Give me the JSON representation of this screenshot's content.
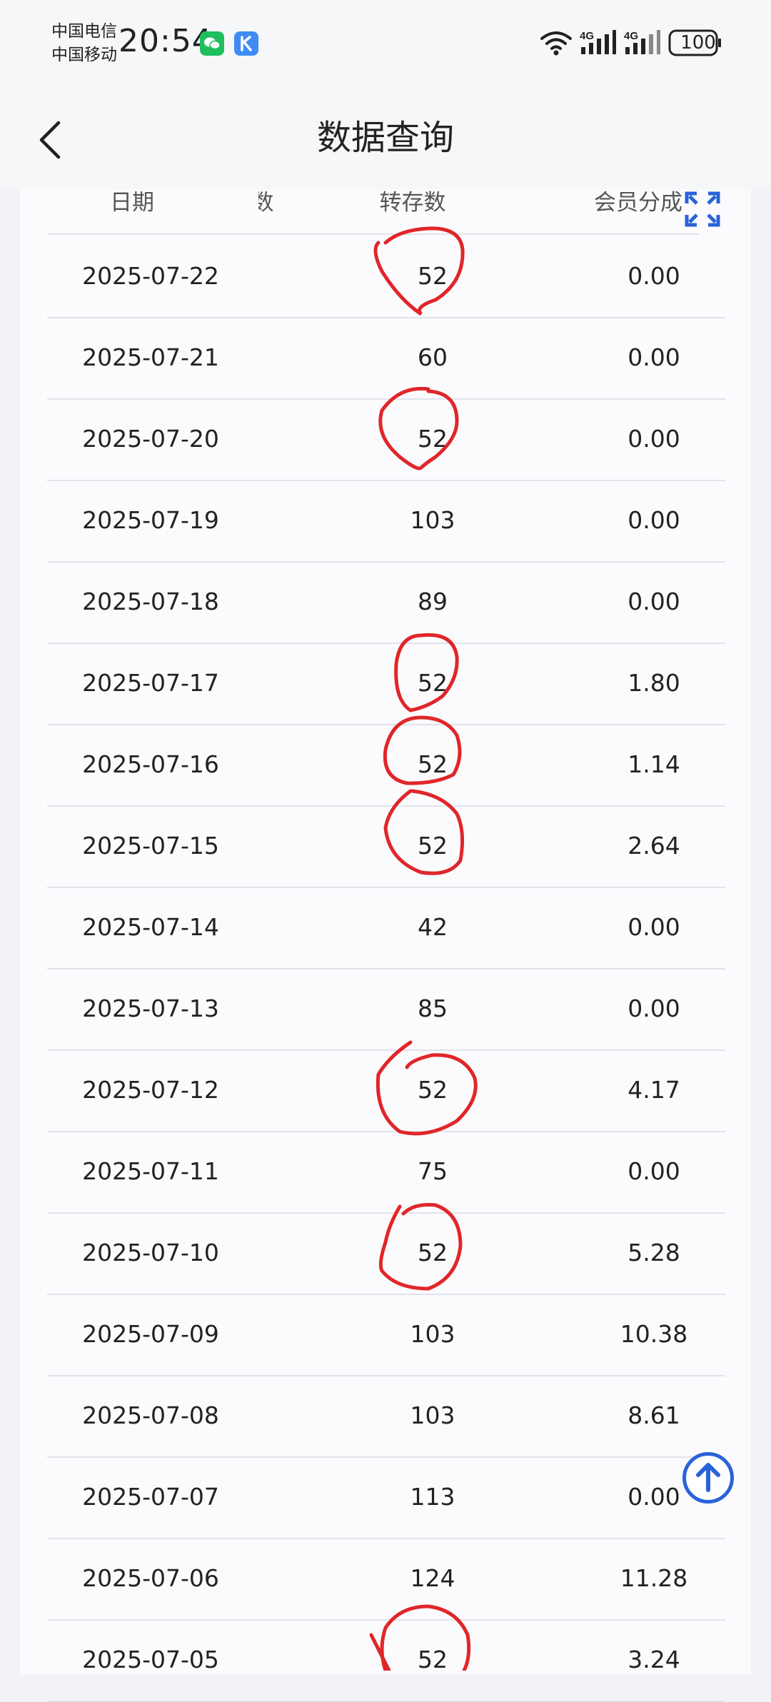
{
  "status_bar": {
    "carrier_1": "中国电信",
    "carrier_2": "中国移动",
    "time": "20:54",
    "battery": "100",
    "icons": [
      "wechat-icon",
      "kuake-app-icon",
      "wifi-icon",
      "signal-4g-icon",
      "signal-4g-icon",
      "battery-icon"
    ]
  },
  "header": {
    "title": "数据查询",
    "back_icon": "chevron-left-icon"
  },
  "table": {
    "columns": [
      "日期",
      "数",
      "转存数",
      "会员分成"
    ],
    "rows": [
      {
        "date": "2025-07-22",
        "saves": "52",
        "share": "0.00"
      },
      {
        "date": "2025-07-21",
        "saves": "60",
        "share": "0.00"
      },
      {
        "date": "2025-07-20",
        "saves": "52",
        "share": "0.00"
      },
      {
        "date": "2025-07-19",
        "saves": "103",
        "share": "0.00"
      },
      {
        "date": "2025-07-18",
        "saves": "89",
        "share": "0.00"
      },
      {
        "date": "2025-07-17",
        "saves": "52",
        "share": "1.80"
      },
      {
        "date": "2025-07-16",
        "saves": "52",
        "share": "1.14"
      },
      {
        "date": "2025-07-15",
        "saves": "52",
        "share": "2.64"
      },
      {
        "date": "2025-07-14",
        "saves": "42",
        "share": "0.00"
      },
      {
        "date": "2025-07-13",
        "saves": "85",
        "share": "0.00"
      },
      {
        "date": "2025-07-12",
        "saves": "52",
        "share": "4.17"
      },
      {
        "date": "2025-07-11",
        "saves": "75",
        "share": "0.00"
      },
      {
        "date": "2025-07-10",
        "saves": "52",
        "share": "5.28"
      },
      {
        "date": "2025-07-09",
        "saves": "103",
        "share": "10.38"
      },
      {
        "date": "2025-07-08",
        "saves": "103",
        "share": "8.61"
      },
      {
        "date": "2025-07-07",
        "saves": "113",
        "share": "0.00"
      },
      {
        "date": "2025-07-06",
        "saves": "124",
        "share": "11.28"
      },
      {
        "date": "2025-07-05",
        "saves": "52",
        "share": "3.24"
      }
    ]
  },
  "annotations": {
    "circled_rows": [
      "2025-07-22",
      "2025-07-20",
      "2025-07-17",
      "2025-07-16",
      "2025-07-15",
      "2025-07-12",
      "2025-07-10",
      "2025-07-05"
    ],
    "circle_color": "#e0262a"
  },
  "controls": {
    "fullscreen_icon": "expand-icon",
    "scroll_top_icon": "arrow-up-circle-icon"
  },
  "colors": {
    "accent": "#2a63d8",
    "divider": "#dfe3ec"
  }
}
